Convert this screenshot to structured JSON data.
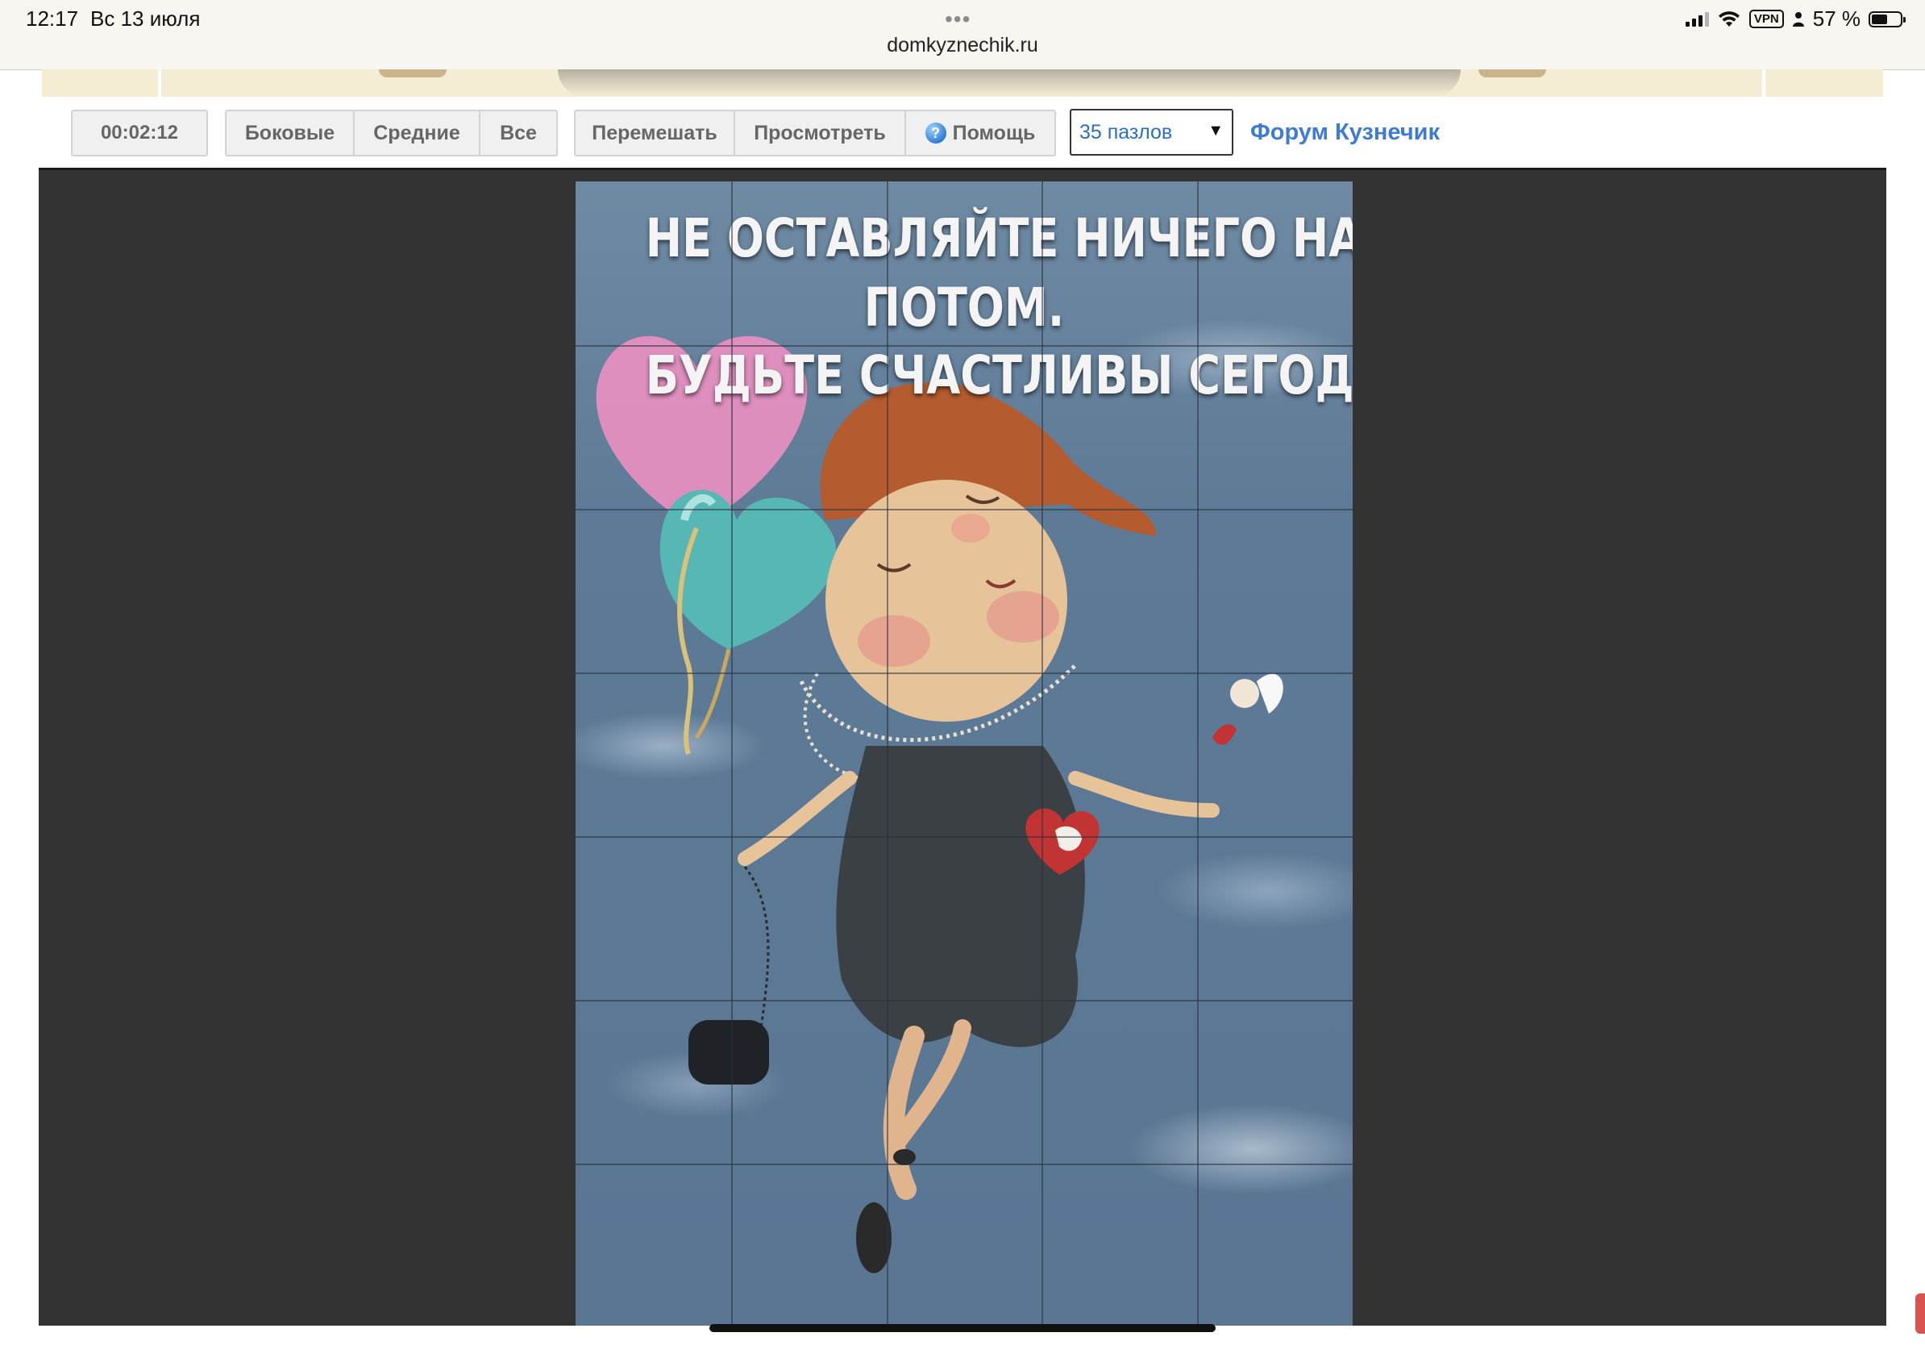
{
  "status_bar": {
    "time": "12:17",
    "date": "Вс 13 июля",
    "dots": "•••",
    "url": "domkyznechik.ru",
    "vpn": "VPN",
    "battery": "57 %",
    "battery_level": 0.57
  },
  "toolbar": {
    "timer": "00:02:12",
    "edge_buttons": [
      "Боковые",
      "Средние",
      "Все"
    ],
    "actions": {
      "shuffle": "Перемешать",
      "preview": "Просмотреть",
      "help": "Помощь"
    },
    "puzzle_count_select": "35 пазлов",
    "forum_link": "Форум Кузнечик"
  },
  "puzzle": {
    "caption_lines": [
      "НЕ ОСТАВЛЯЙТЕ НИЧЕГО НА",
      "ПОТОМ.",
      "БУДЬТЕ СЧАСТЛИВЫ СЕГОДНЯ!!!"
    ],
    "columns": 5,
    "rows": 7
  },
  "colors": {
    "accent_link": "#3f7bd3",
    "board_bg": "#333333",
    "button_bg": "#f0f0f0"
  }
}
